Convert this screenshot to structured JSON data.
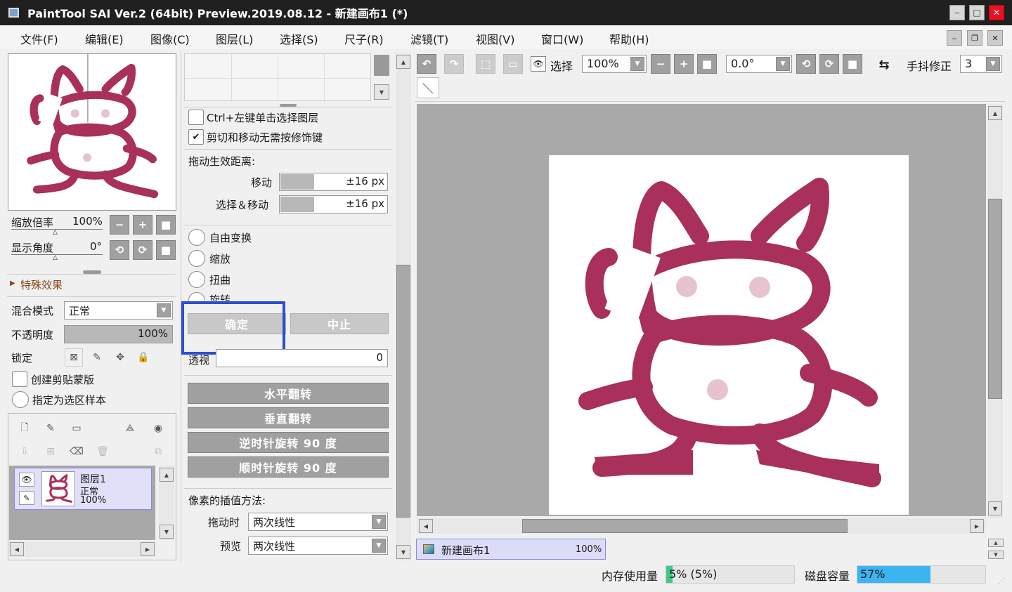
{
  "window": {
    "title": "PaintTool SAI Ver.2 (64bit) Preview.2019.08.12 - 新建画布1 (*)",
    "minimize": "‒",
    "maximize": "□",
    "close": "✕"
  },
  "menu": [
    "文件(F)",
    "编辑(E)",
    "图像(C)",
    "图层(L)",
    "选择(S)",
    "尺子(R)",
    "滤镜(T)",
    "视图(V)",
    "窗口(W)",
    "帮助(H)"
  ],
  "navigator": {
    "zoom_label": "缩放倍率",
    "zoom_value": "100%",
    "angle_label": "显示角度",
    "angle_value": "0°"
  },
  "effects": {
    "header": "特殊效果"
  },
  "layer_props": {
    "blend_label": "混合模式",
    "blend_value": "正常",
    "opacity_label": "不透明度",
    "opacity_value": "100%",
    "lock_label": "锁定",
    "clip_label": "创建剪贴蒙版",
    "selection_sample_label": "指定为选区样本"
  },
  "layers": [
    {
      "name": "图层1",
      "mode": "正常",
      "opacity": "100%"
    }
  ],
  "tool_options": {
    "ctrl_click_label": "Ctrl+左键单击选择图层",
    "ctrl_click_checked": false,
    "no_modifier_label": "剪切和移动无需按修饰键",
    "no_modifier_checked": true,
    "drag_distance_label": "拖动生效距离:",
    "move_label": "移动",
    "move_value": "±16 px",
    "select_move_label": "选择＆移动",
    "select_move_value": "±16 px",
    "transform_modes": [
      "自由变换",
      "缩放",
      "扭曲",
      "旋转"
    ],
    "ok_button": "确定",
    "cancel_button": "中止",
    "perspective_label": "透视",
    "perspective_value": "0",
    "flip_h": "水平翻转",
    "flip_v": "垂直翻转",
    "rotate_ccw": "逆时针旋转 90 度",
    "rotate_cw": "顺时针旋转 90 度",
    "interp_label": "像素的插值方法:",
    "drag_interp_label": "拖动时",
    "drag_interp_value": "两次线性",
    "preview_interp_label": "预览",
    "preview_interp_value": "两次线性"
  },
  "toolbar": {
    "select_label": "选择",
    "zoom_value": "100%",
    "angle_value": "0.0°",
    "stabilizer_label": "手抖修正",
    "stabilizer_value": "3"
  },
  "canvas_tab": {
    "name": "新建画布1",
    "zoom": "100%"
  },
  "status": {
    "memory_label": "内存使用量",
    "memory_value": "5% (5%)",
    "memory_fraction": 0.05,
    "disk_label": "磁盘容量",
    "disk_value": "57%",
    "disk_fraction": 0.57
  },
  "colors": {
    "drawing": "#a8305a",
    "blush": "#e6c3cf",
    "highlight_box": "#2b4fcf",
    "memory_bar": "#3ec98a",
    "disk_bar": "#3cb4f0"
  }
}
